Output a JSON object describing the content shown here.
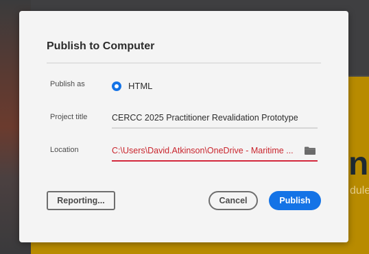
{
  "background": {
    "big_text": "ne",
    "small_text": "dule",
    "colors": {
      "accent_yellow": "#b88b00"
    }
  },
  "dialog": {
    "title": "Publish to Computer",
    "publish_as": {
      "label": "Publish as",
      "option": "HTML",
      "selected": true
    },
    "project_title": {
      "label": "Project title",
      "value": "CERCC 2025 Practitioner Revalidation Prototype"
    },
    "location": {
      "label": "Location",
      "value": "C:\\Users\\David.Atkinson\\OneDrive - Maritime ...",
      "icon": "folder-icon",
      "error_color": "#d3273b"
    },
    "buttons": {
      "reporting": "Reporting...",
      "cancel": "Cancel",
      "publish": "Publish"
    },
    "colors": {
      "primary": "#1473e6"
    }
  }
}
